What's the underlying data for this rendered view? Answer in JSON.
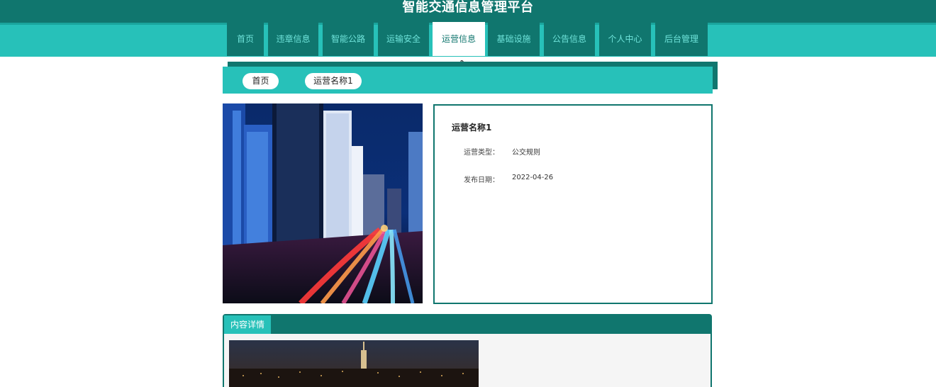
{
  "site": {
    "title": "智能交通信息管理平台"
  },
  "nav": {
    "items": [
      {
        "label": "首页"
      },
      {
        "label": "违章信息"
      },
      {
        "label": "智能公路"
      },
      {
        "label": "运输安全"
      },
      {
        "label": "运营信息",
        "active": true
      },
      {
        "label": "基础设施"
      },
      {
        "label": "公告信息"
      },
      {
        "label": "个人中心"
      },
      {
        "label": "后台管理"
      }
    ]
  },
  "breadcrumb": {
    "home": "首页",
    "current": "运营名称1"
  },
  "detail": {
    "name": "运营名称1",
    "type_label": "运营类型：",
    "type_value": "公交规则",
    "date_label": "发布日期：",
    "date_value": "2022-04-26"
  },
  "content": {
    "tab_label": "内容详情"
  },
  "colors": {
    "dark_teal": "#10766e",
    "light_teal": "#27c1b9"
  }
}
